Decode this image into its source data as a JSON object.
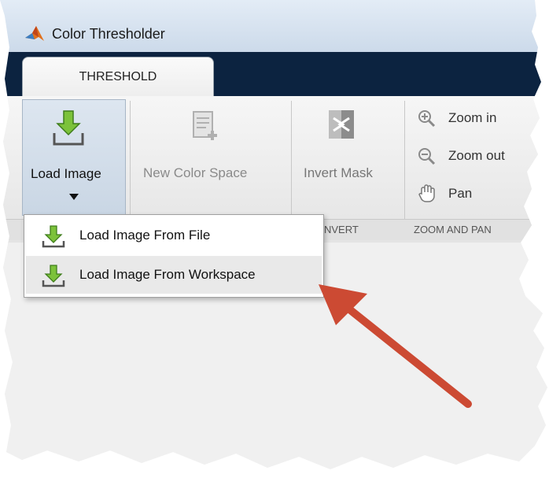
{
  "window": {
    "title": "Color Thresholder"
  },
  "tabs": [
    {
      "label": "THRESHOLD"
    }
  ],
  "toolstrip": {
    "load_image_label": "Load Image",
    "new_color_space_label": "New Color Space",
    "invert_mask_label": "Invert Mask",
    "zoom_in_label": "Zoom in",
    "zoom_out_label": "Zoom out",
    "pan_label": "Pan",
    "sections": {
      "invert": "NVERT",
      "zoom_and_pan": "ZOOM AND PAN"
    }
  },
  "dropdown": {
    "items": [
      {
        "label": "Load Image From File",
        "icon": "download-icon"
      },
      {
        "label": "Load Image From Workspace",
        "icon": "download-icon"
      }
    ]
  },
  "colors": {
    "tabstrip": "#0c2340",
    "menu_icon_green": "#4caf2f",
    "annotation_arrow": "#cc4a33"
  }
}
